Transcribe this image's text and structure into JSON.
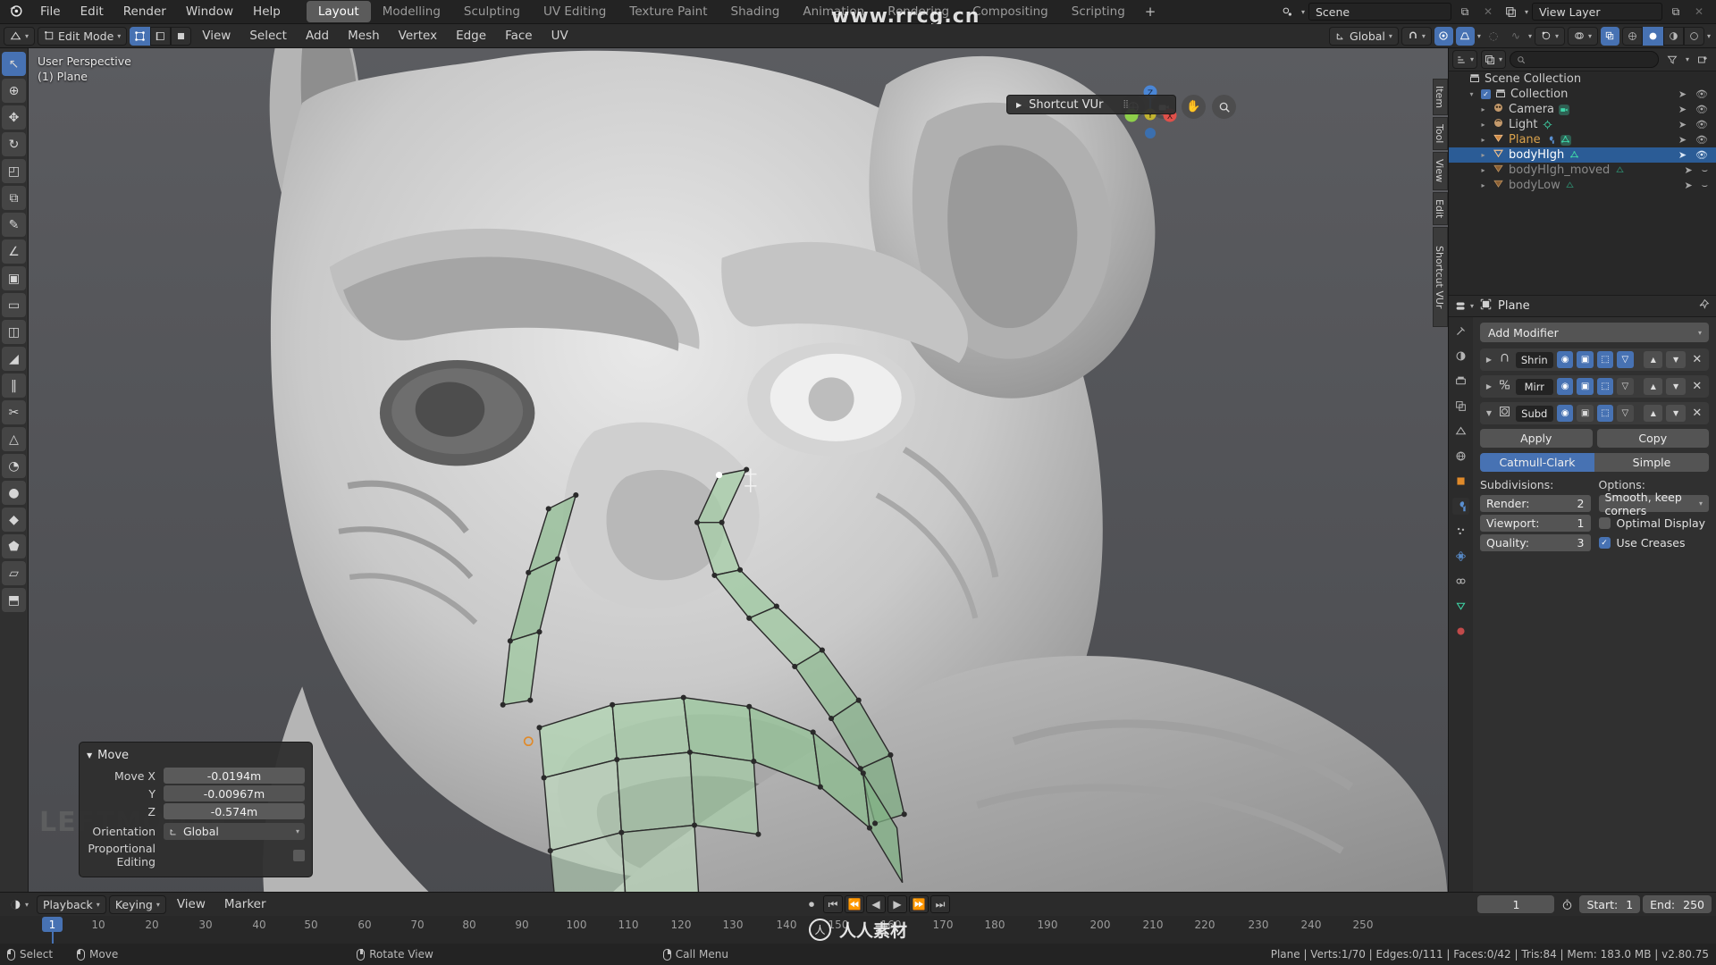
{
  "app": {
    "logo_icon": "blender-logo",
    "menus": [
      "File",
      "Edit",
      "Render",
      "Window",
      "Help"
    ],
    "workspace_tabs": [
      {
        "label": "Layout",
        "active": true
      },
      {
        "label": "Modelling",
        "active": false
      },
      {
        "label": "Sculpting",
        "active": false
      },
      {
        "label": "UV Editing",
        "active": false
      },
      {
        "label": "Texture Paint",
        "active": false
      },
      {
        "label": "Shading",
        "active": false
      },
      {
        "label": "Animation",
        "active": false
      },
      {
        "label": "Rendering",
        "active": false
      },
      {
        "label": "Compositing",
        "active": false
      },
      {
        "label": "Scripting",
        "active": false
      },
      {
        "label": "+",
        "active": false
      }
    ],
    "scene_name": "Scene",
    "view_layer_name": "View Layer",
    "scene_icon": "scene-icon",
    "view_layer_icon": "view-layer-icon",
    "copy_icon": "duplicate-icon",
    "close_icon": "x-icon"
  },
  "viewport_header": {
    "editor_type_icon": "editor-type-icon",
    "mode": "Edit Mode",
    "select_modes": [
      "vertex-select-icon",
      "edge-select-icon",
      "face-select-icon"
    ],
    "select_mode_active_index": 0,
    "menus": [
      "View",
      "Select",
      "Add",
      "Mesh",
      "Vertex",
      "Edge",
      "Face",
      "UV"
    ],
    "transform_orientation": "Global",
    "snap_icon": "magnet-icon",
    "proportional_icon": "proportional-editing-icon",
    "proportional_falloff_icon": "falloff-curve-icon",
    "shading_icons": [
      "wireframe-icon",
      "solid-icon",
      "material-preview-icon",
      "rendered-icon"
    ],
    "overlay_icon": "overlays-icon",
    "xray_icon": "xray-icon",
    "gizmo_icon": "gizmo-icon",
    "visibility_icon": "visibility-icon"
  },
  "viewport": {
    "perspective_label": "User Perspective",
    "active_object_label": "(1) Plane",
    "gizmo_axes": [
      {
        "label": "Z",
        "color": "#4772b3"
      },
      {
        "label": "X",
        "color": "#e04a4a"
      },
      {
        "label": "Y",
        "color": "#7ec142"
      }
    ],
    "nav_icons": [
      "zoom-icon",
      "camera-icon",
      "hand-icon",
      "magnifier-icon"
    ],
    "shortcut_panel": {
      "label": "Shortcut VUr",
      "expand_icon": "triangle-right-icon",
      "grip_icon": "grip-dots-icon"
    },
    "side_tabs": [
      "Item",
      "Tool",
      "View",
      "Edit",
      "Shortcut VUr"
    ],
    "mouse_hint": "LEFTMOUSE"
  },
  "toolshelf": {
    "tools": [
      {
        "name": "tweak-tool",
        "glyph": "↖",
        "selected": true
      },
      {
        "name": "cursor-tool",
        "glyph": "⊕",
        "selected": false
      },
      {
        "name": "move-tool",
        "glyph": "✥",
        "selected": false
      },
      {
        "name": "rotate-tool",
        "glyph": "↻",
        "selected": false
      },
      {
        "name": "scale-tool",
        "glyph": "◰",
        "selected": false
      },
      {
        "name": "transform-tool",
        "glyph": "⧉",
        "selected": false
      },
      {
        "name": "annotate-tool",
        "glyph": "✎",
        "selected": false
      },
      {
        "name": "measure-tool",
        "glyph": "∠",
        "selected": false
      },
      {
        "name": "add-cube-tool",
        "glyph": "▣",
        "selected": false
      },
      {
        "name": "extrude-tool",
        "glyph": "▭",
        "selected": false
      },
      {
        "name": "inset-faces-tool",
        "glyph": "◫",
        "selected": false
      },
      {
        "name": "bevel-tool",
        "glyph": "◢",
        "selected": false
      },
      {
        "name": "loop-cut-tool",
        "glyph": "‖",
        "selected": false
      },
      {
        "name": "knife-tool",
        "glyph": "✂",
        "selected": false
      },
      {
        "name": "poly-build-tool",
        "glyph": "△",
        "selected": false
      },
      {
        "name": "spin-tool",
        "glyph": "◔",
        "selected": false
      },
      {
        "name": "smooth-tool",
        "glyph": "●",
        "selected": false
      },
      {
        "name": "edge-slide-tool",
        "glyph": "◆",
        "selected": false
      },
      {
        "name": "shrink-fatten-tool",
        "glyph": "⬟",
        "selected": false
      },
      {
        "name": "shear-tool",
        "glyph": "▱",
        "selected": false
      },
      {
        "name": "rip-region-tool",
        "glyph": "⬒",
        "selected": false
      }
    ]
  },
  "operator_panel": {
    "title": "Move",
    "collapse_icon": "triangle-down-icon",
    "fields": [
      {
        "label": "Move X",
        "value": "-0.0194m"
      },
      {
        "label": "Y",
        "value": "-0.00967m"
      },
      {
        "label": "Z",
        "value": "-0.574m"
      }
    ],
    "orientation_label": "Orientation",
    "orientation_value": "Global",
    "orientation_icon": "orientation-icon",
    "proportional_label": "Proportional Editing",
    "proportional_checked": false
  },
  "outliner": {
    "header_icons": [
      "editor-type-icon",
      "display-mode-icon",
      "search-icon",
      "filter-icon",
      "new-collection-icon"
    ],
    "search_placeholder": "",
    "rows": [
      {
        "label": "Scene Collection",
        "icon": "collection-icon",
        "indent": 0,
        "tri": "",
        "selected": false,
        "dim": false,
        "checkbox": false,
        "extra_icons": [],
        "arrow": false,
        "eye": false
      },
      {
        "label": "Collection",
        "icon": "collection-icon",
        "indent": 1,
        "tri": "▾",
        "selected": false,
        "dim": false,
        "checkbox": true,
        "extra_icons": [],
        "arrow": true,
        "eye": true
      },
      {
        "label": "Camera",
        "icon": "camera-object-icon",
        "indent": 2,
        "tri": "▸",
        "selected": false,
        "dim": false,
        "checkbox": false,
        "extra_icons": [
          "camera-data-icon"
        ],
        "arrow": true,
        "eye": true
      },
      {
        "label": "Light",
        "icon": "light-object-icon",
        "indent": 2,
        "tri": "▸",
        "selected": false,
        "dim": false,
        "checkbox": false,
        "extra_icons": [
          "light-data-icon"
        ],
        "arrow": true,
        "eye": true
      },
      {
        "label": "Plane",
        "icon": "mesh-object-icon",
        "indent": 2,
        "tri": "▸",
        "selected": false,
        "dim": false,
        "checkbox": false,
        "extra_icons": [
          "modifier-icon",
          "mesh-data-icon"
        ],
        "arrow": true,
        "eye": true,
        "orange": true
      },
      {
        "label": "bodyHIgh",
        "icon": "mesh-object-icon",
        "indent": 2,
        "tri": "▸",
        "selected": true,
        "dim": false,
        "checkbox": false,
        "extra_icons": [
          "mesh-data-icon"
        ],
        "arrow": true,
        "eye": true
      },
      {
        "label": "bodyHIgh_moved",
        "icon": "mesh-object-icon",
        "indent": 2,
        "tri": "▸",
        "selected": false,
        "dim": true,
        "checkbox": false,
        "extra_icons": [
          "mesh-data-icon"
        ],
        "arrow": true,
        "eye": false
      },
      {
        "label": "bodyLow",
        "icon": "mesh-object-icon",
        "indent": 2,
        "tri": "▸",
        "selected": false,
        "dim": true,
        "checkbox": false,
        "extra_icons": [
          "mesh-data-icon"
        ],
        "arrow": true,
        "eye": false
      }
    ]
  },
  "properties": {
    "breadcrumb_object": "Plane",
    "breadcrumb_icon": "object-icon",
    "pin_icon": "pin-icon",
    "editor_icon": "properties-editor-icon",
    "tabs": [
      {
        "name": "tool-tab",
        "glyph": "⚒",
        "active": false
      },
      {
        "name": "render-tab",
        "glyph": "◓",
        "active": false
      },
      {
        "name": "output-tab",
        "glyph": "⎙",
        "active": false
      },
      {
        "name": "view-layer-tab",
        "glyph": "❐",
        "active": false
      },
      {
        "name": "scene-tab",
        "glyph": "△",
        "active": false
      },
      {
        "name": "world-tab",
        "glyph": "☀",
        "active": false
      },
      {
        "name": "object-tab",
        "glyph": "▣",
        "active": false
      },
      {
        "name": "modifier-tab",
        "glyph": "ὒ7",
        "active": true
      },
      {
        "name": "particles-tab",
        "glyph": "⁂",
        "active": false
      },
      {
        "name": "physics-tab",
        "glyph": "◌",
        "active": false
      },
      {
        "name": "constraints-tab",
        "glyph": "⛓",
        "active": false
      },
      {
        "name": "data-tab",
        "glyph": "▽",
        "active": false
      },
      {
        "name": "material-tab",
        "glyph": "●",
        "active": false
      }
    ],
    "add_modifier_label": "Add Modifier",
    "modifiers": [
      {
        "name": "Shrin",
        "icon": "shrinkwrap-icon",
        "expanded": false,
        "toggles": [
          {
            "name": "render-toggle",
            "glyph": "◉",
            "on": true
          },
          {
            "name": "viewport-toggle",
            "glyph": "▣",
            "on": true
          },
          {
            "name": "edit-mode-toggle",
            "glyph": "⬚",
            "on": true
          },
          {
            "name": "cage-toggle",
            "glyph": "▽",
            "on": true
          }
        ]
      },
      {
        "name": "Mirr",
        "icon": "mirror-icon",
        "expanded": false,
        "toggles": [
          {
            "name": "render-toggle",
            "glyph": "◉",
            "on": true
          },
          {
            "name": "viewport-toggle",
            "glyph": "▣",
            "on": true
          },
          {
            "name": "edit-mode-toggle",
            "glyph": "⬚",
            "on": true
          },
          {
            "name": "cage-toggle",
            "glyph": "▽",
            "on": false
          }
        ]
      },
      {
        "name": "Subd",
        "icon": "subsurf-icon",
        "expanded": true,
        "toggles": [
          {
            "name": "render-toggle",
            "glyph": "◉",
            "on": true
          },
          {
            "name": "viewport-toggle",
            "glyph": "▣",
            "on": false
          },
          {
            "name": "edit-mode-toggle",
            "glyph": "⬚",
            "on": true
          },
          {
            "name": "cage-toggle",
            "glyph": "▽",
            "on": false
          }
        ]
      }
    ],
    "apply_label": "Apply",
    "copy_label": "Copy",
    "subdiv_types": [
      {
        "label": "Catmull-Clark",
        "active": true
      },
      {
        "label": "Simple",
        "active": false
      }
    ],
    "subdivisions_label": "Subdivisions:",
    "options_label": "Options:",
    "subdiv_rows": [
      {
        "label": "Render:",
        "value": "2"
      },
      {
        "label": "Viewport:",
        "value": "1"
      },
      {
        "label": "Quality:",
        "value": "3"
      }
    ],
    "uv_smooth": "Smooth, keep corners",
    "optimal_display_label": "Optimal Display",
    "optimal_display_checked": false,
    "use_creases_label": "Use Creases",
    "use_creases_checked": true
  },
  "timeline": {
    "editor_icon": "timeline-editor-icon",
    "menus": [
      "Playback",
      "Keying",
      "View",
      "Marker"
    ],
    "playback_icons": [
      "record-icon",
      "jump-start-icon",
      "prev-keyframe-icon",
      "play-reverse-icon",
      "play-icon",
      "next-keyframe-icon",
      "jump-end-icon"
    ],
    "current_frame": "1",
    "auto_key_icon": "stopwatch-icon",
    "start_label": "Start:",
    "start_value": "1",
    "end_label": "End:",
    "end_value": "250",
    "ticks": [
      1,
      10,
      20,
      30,
      40,
      50,
      60,
      70,
      80,
      90,
      100,
      110,
      120,
      130,
      140,
      150,
      160,
      170,
      180,
      190,
      200,
      210,
      220,
      230,
      240,
      250
    ],
    "playhead_frame": "1"
  },
  "status_bar": {
    "hints": [
      {
        "mouse": "left",
        "label": "Select"
      },
      {
        "mouse": "left-drag",
        "label": "Move"
      },
      {
        "mouse": "middle",
        "label": "Rotate View"
      },
      {
        "mouse": "right",
        "label": "Call Menu"
      }
    ],
    "stats": "Plane | Verts:1/70 | Edges:0/111 | Faces:0/42 | Tris:84 | Mem: 183.0 MB | v2.80.75"
  },
  "watermarks": {
    "url": "www.rrcg.cn",
    "brand": "人人素材",
    "brand_icon": "rr-logo"
  },
  "colors": {
    "accent_blue": "#4772b3",
    "selected_row": "#2b5c96",
    "orange_text": "#d9a24c",
    "mesh_green": "#3fd6a8"
  }
}
